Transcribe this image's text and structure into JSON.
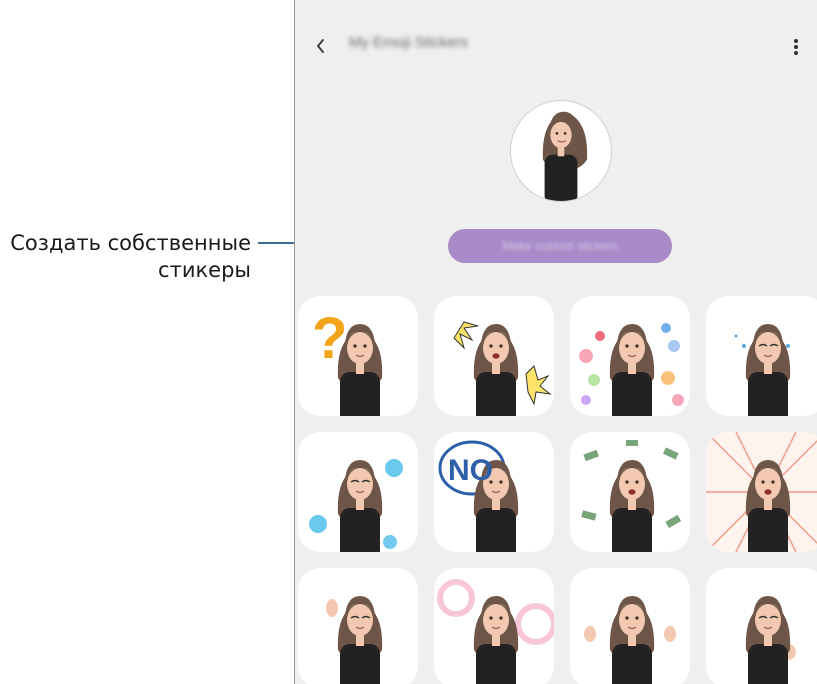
{
  "callout": {
    "line1": "Создать собственные",
    "line2": "стикеры"
  },
  "topbar": {
    "back_icon": "back-arrow-icon",
    "title": "My Emoji Stickers",
    "more_icon": "more-vertical-icon"
  },
  "profile": {
    "avatar": "avatar-emoji"
  },
  "make_button": {
    "label": "Make custom stickers"
  },
  "colors": {
    "screen_bg": "#efefef",
    "accent_button": "#a88bc8",
    "callout_line": "#3a6f9a",
    "hair": "#6d5547",
    "skin": "#f2c9b0",
    "top": "#222222"
  },
  "stickers": [
    {
      "name": "sticker-question"
    },
    {
      "name": "sticker-excited-burst"
    },
    {
      "name": "sticker-hearts"
    },
    {
      "name": "sticker-crying"
    },
    {
      "name": "sticker-tired-skulls"
    },
    {
      "name": "sticker-no",
      "text": "NO"
    },
    {
      "name": "sticker-money-rain"
    },
    {
      "name": "sticker-angry-burst"
    },
    {
      "name": "sticker-wave"
    },
    {
      "name": "sticker-bubbles"
    },
    {
      "name": "sticker-shrug"
    },
    {
      "name": "sticker-wink-fist"
    }
  ]
}
